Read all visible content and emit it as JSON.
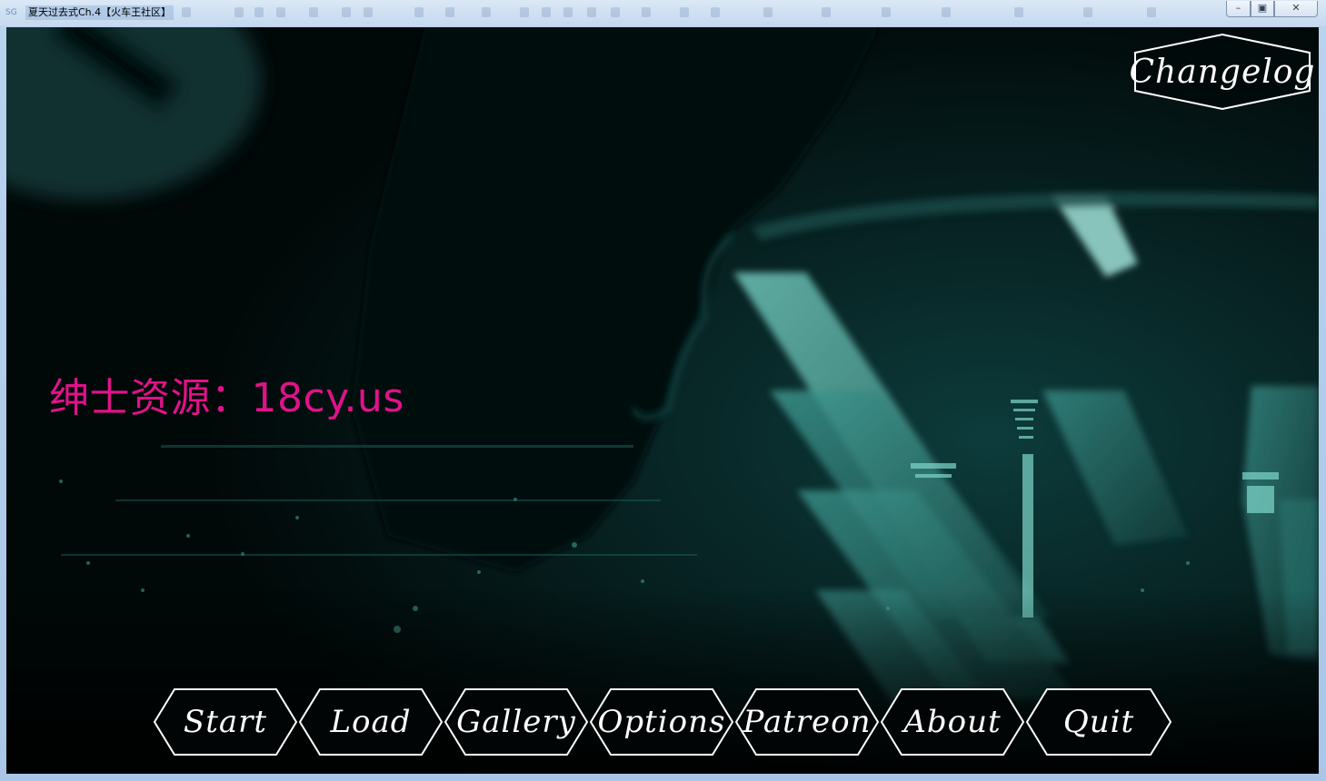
{
  "window": {
    "title": "夏天过去式Ch.4【火车王社区】",
    "app_icon": "SG",
    "controls": {
      "minimize": "minimize-icon",
      "maximize": "maximize-icon",
      "close": "close-icon"
    }
  },
  "watermark": "绅士资源：18cy.us",
  "changelog_label": "Changelog",
  "menu": [
    {
      "id": "start",
      "label": "Start"
    },
    {
      "id": "load",
      "label": "Load"
    },
    {
      "id": "gallery",
      "label": "Gallery"
    },
    {
      "id": "options",
      "label": "Options"
    },
    {
      "id": "patreon",
      "label": "Patreon"
    },
    {
      "id": "about",
      "label": "About"
    },
    {
      "id": "quit",
      "label": "Quit"
    }
  ],
  "colors": {
    "background": "#010a0a",
    "accent_teal": "#1e6f6a",
    "button_outline": "#ffffff",
    "watermark": "#e0128a"
  }
}
